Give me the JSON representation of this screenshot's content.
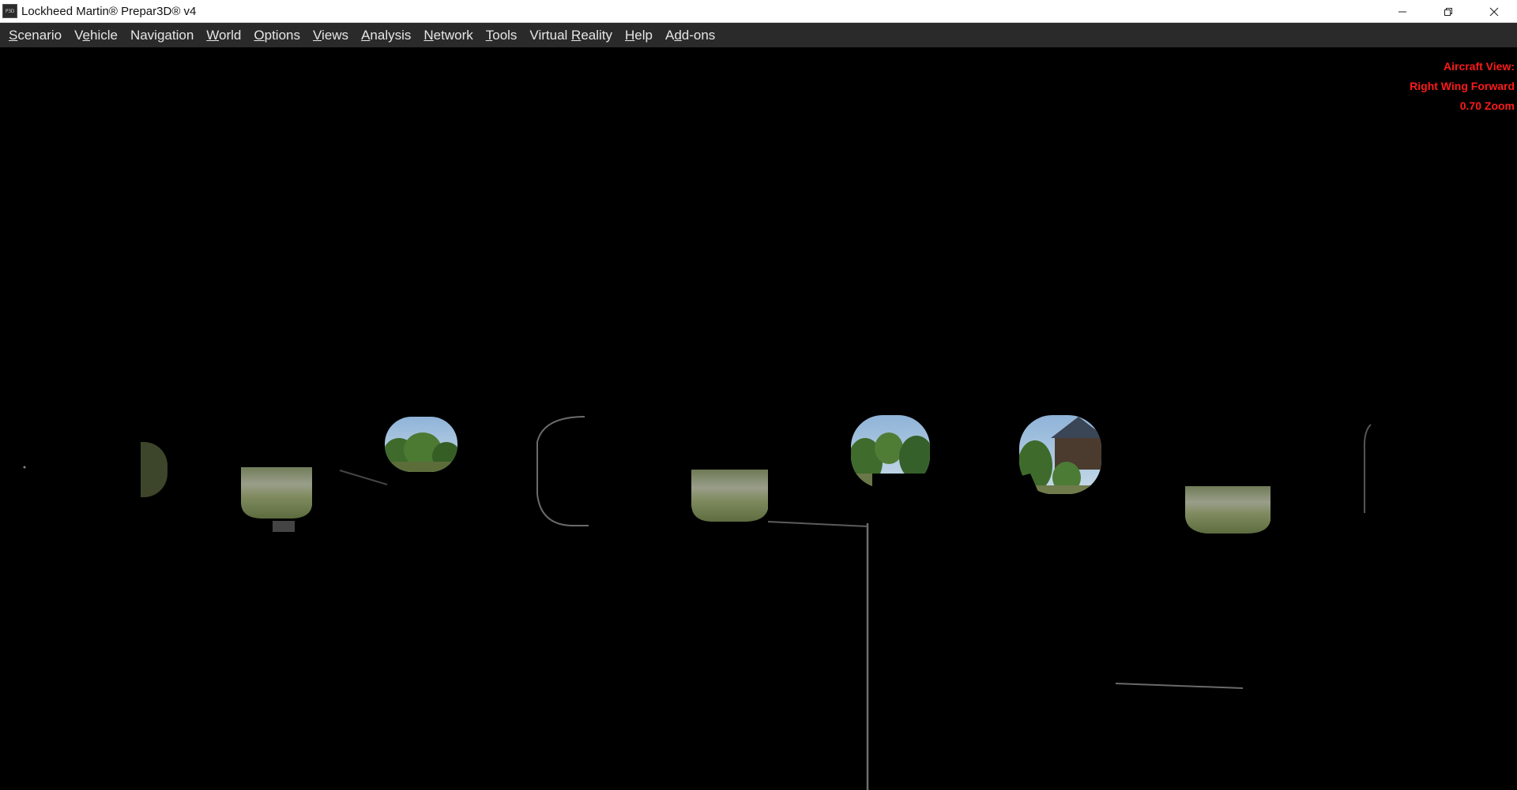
{
  "window": {
    "title": "Lockheed Martin® Prepar3D® v4",
    "icon_text": "P3D"
  },
  "menu": {
    "items": [
      {
        "label": "Scenario",
        "mnemonic_index": 0
      },
      {
        "label": "Vehicle",
        "mnemonic_index": 1
      },
      {
        "label": "Navigation",
        "mnemonic_index": -1
      },
      {
        "label": "World",
        "mnemonic_index": 0
      },
      {
        "label": "Options",
        "mnemonic_index": 0
      },
      {
        "label": "Views",
        "mnemonic_index": 0
      },
      {
        "label": "Analysis",
        "mnemonic_index": 0
      },
      {
        "label": "Network",
        "mnemonic_index": 0
      },
      {
        "label": "Tools",
        "mnemonic_index": 0
      },
      {
        "label": "Virtual Reality",
        "mnemonic_index": 8
      },
      {
        "label": "Help",
        "mnemonic_index": 0
      },
      {
        "label": "Add-ons",
        "mnemonic_index": 1
      }
    ]
  },
  "view_info": {
    "line1": "Aircraft View:",
    "line2": "Right Wing Forward",
    "line3": "0.70 Zoom",
    "color": "#ff1a1a"
  },
  "icons": {
    "minimize": "minimize-icon",
    "restore": "restore-icon",
    "close": "close-icon"
  }
}
